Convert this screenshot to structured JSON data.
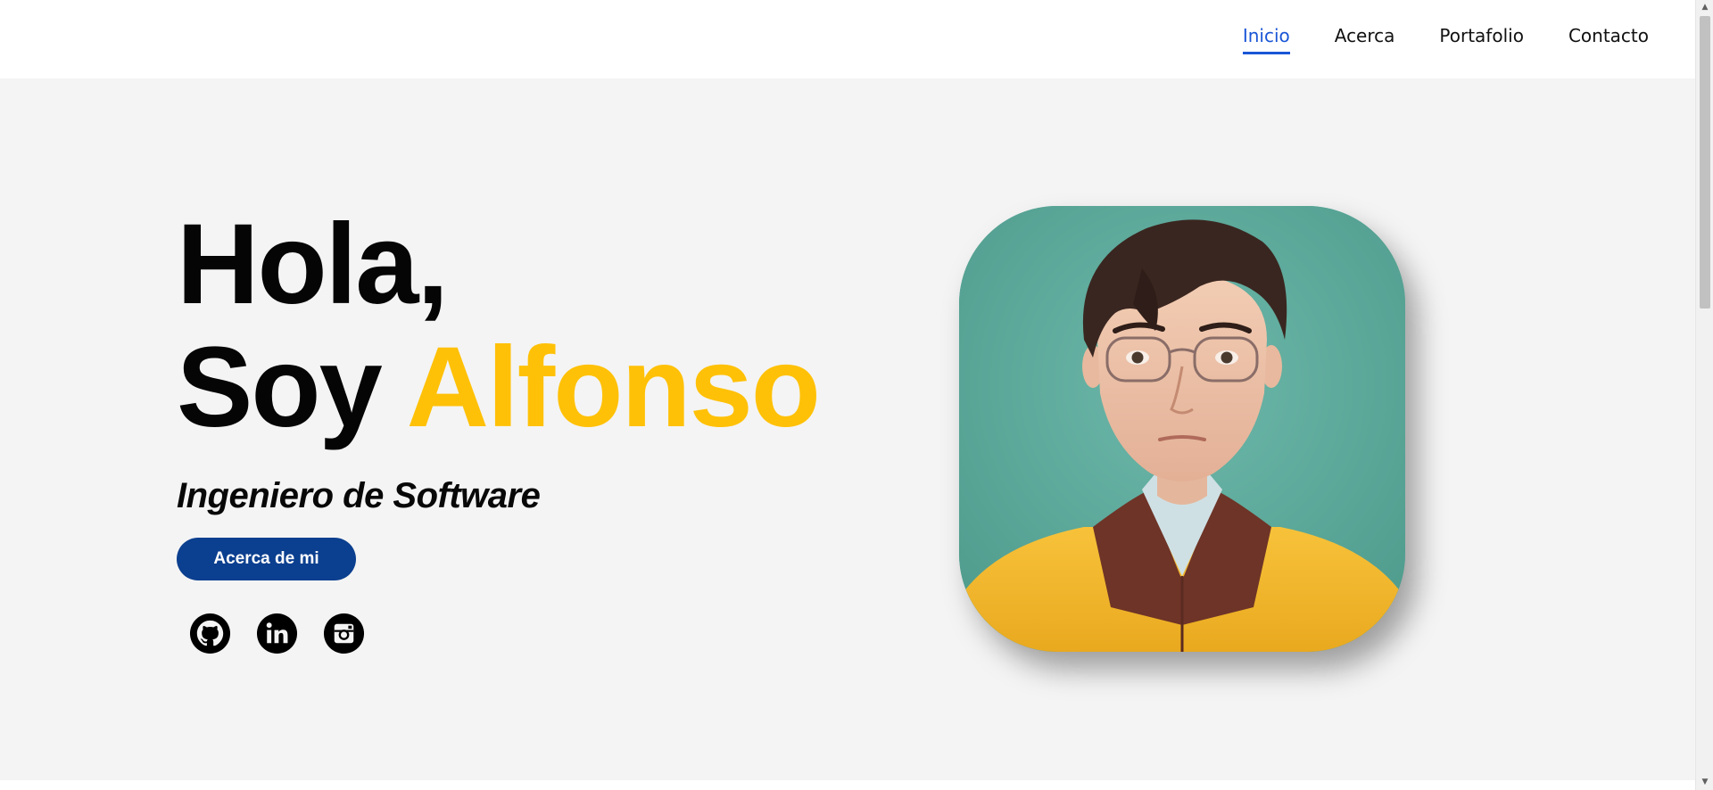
{
  "nav": {
    "items": [
      {
        "label": "Inicio",
        "active": true
      },
      {
        "label": "Acerca",
        "active": false
      },
      {
        "label": "Portafolio",
        "active": false
      },
      {
        "label": "Contacto",
        "active": false
      }
    ]
  },
  "hero": {
    "greeting": "Hola,",
    "intro_prefix": "Soy",
    "name": "Alfonso",
    "subtitle": "Ingeniero de Software",
    "button_label": "Acerca de mi"
  },
  "socials": [
    {
      "icon": "github-icon"
    },
    {
      "icon": "linkedin-icon"
    },
    {
      "icon": "instagram-icon"
    }
  ],
  "colors": {
    "accent": "#ffc107",
    "primary_button": "#0b3f8f",
    "nav_active": "#1a56d6",
    "background": "#f4f4f4"
  }
}
